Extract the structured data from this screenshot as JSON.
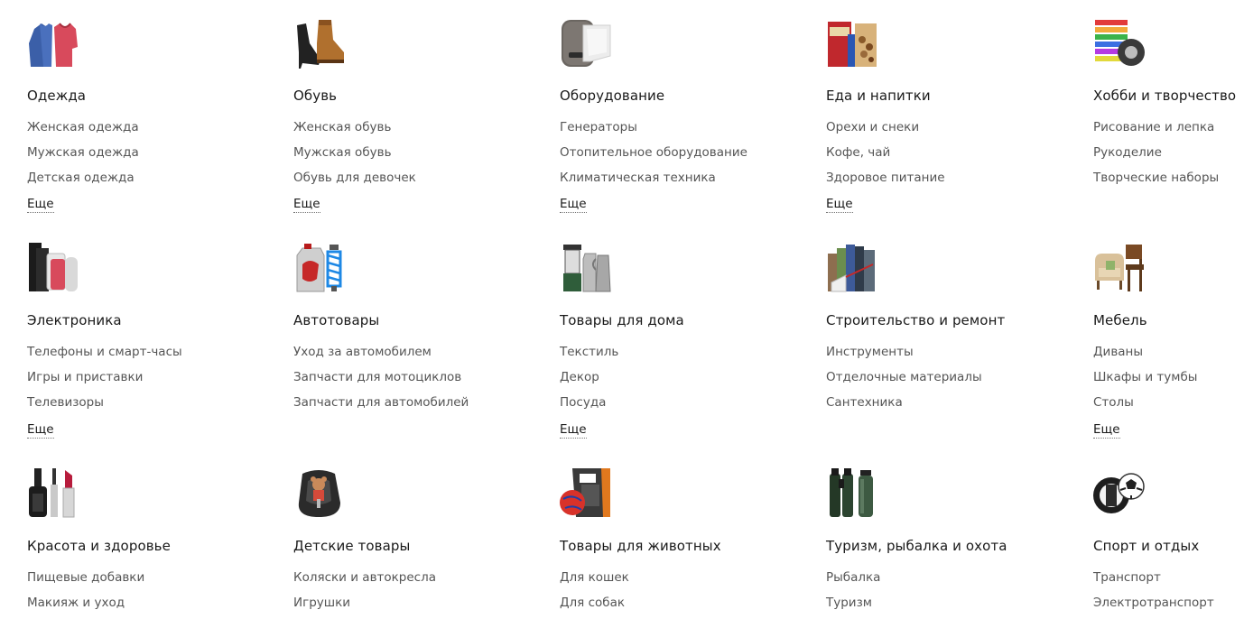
{
  "categories": [
    {
      "title": "Одежда",
      "links": [
        "Женская одежда",
        "Мужская одежда",
        "Детская одежда"
      ],
      "more": "Еще",
      "icon": "clothing-icon"
    },
    {
      "title": "Обувь",
      "links": [
        "Женская обувь",
        "Мужская обувь",
        "Обувь для девочек"
      ],
      "more": "Еще",
      "icon": "shoes-icon"
    },
    {
      "title": "Оборудование",
      "links": [
        "Генераторы",
        "Отопительное оборудование",
        "Климатическая техника"
      ],
      "more": "Еще",
      "icon": "water-heater-icon"
    },
    {
      "title": "Еда и напитки",
      "links": [
        "Орехи и снеки",
        "Кофе, чай",
        "Здоровое питание"
      ],
      "more": "Еще",
      "icon": "food-icon"
    },
    {
      "title": "Хобби и творчество",
      "links": [
        "Рисование и лепка",
        "Рукоделие",
        "Творческие наборы"
      ],
      "more": "",
      "icon": "hobby-icon"
    },
    {
      "title": "Электроника",
      "links": [
        "Телефоны и смарт-часы",
        "Игры и приставки",
        "Телевизоры"
      ],
      "more": "Еще",
      "icon": "electronics-icon"
    },
    {
      "title": "Автотовары",
      "links": [
        "Уход за автомобилем",
        "Запчасти для мотоциклов",
        "Запчасти для автомобилей"
      ],
      "more": "",
      "icon": "auto-parts-icon"
    },
    {
      "title": "Товары для дома",
      "links": [
        "Текстиль",
        "Декор",
        "Посуда"
      ],
      "more": "Еще",
      "icon": "home-goods-icon"
    },
    {
      "title": "Строительство и ремонт",
      "links": [
        "Инструменты",
        "Отделочные материалы",
        "Сантехника"
      ],
      "more": "",
      "icon": "wallpaper-rolls-icon"
    },
    {
      "title": "Мебель",
      "links": [
        "Диваны",
        "Шкафы и тумбы",
        "Столы"
      ],
      "more": "Еще",
      "icon": "furniture-icon"
    },
    {
      "title": "Красота и здоровье",
      "links": [
        "Пищевые добавки",
        "Макияж и уход"
      ],
      "more": "",
      "icon": "cosmetics-icon"
    },
    {
      "title": "Детские товары",
      "links": [
        "Коляски и автокресла",
        "Игрушки"
      ],
      "more": "",
      "icon": "child-car-seat-icon"
    },
    {
      "title": "Товары для животных",
      "links": [
        "Для кошек",
        "Для собак"
      ],
      "more": "",
      "icon": "pet-food-icon"
    },
    {
      "title": "Туризм, рыбалка и охота",
      "links": [
        "Рыбалка",
        "Туризм"
      ],
      "more": "",
      "icon": "binoculars-icon"
    },
    {
      "title": "Спорт и отдых",
      "links": [
        "Транспорт",
        "Электротранспорт"
      ],
      "more": "",
      "icon": "monowheel-icon"
    }
  ]
}
